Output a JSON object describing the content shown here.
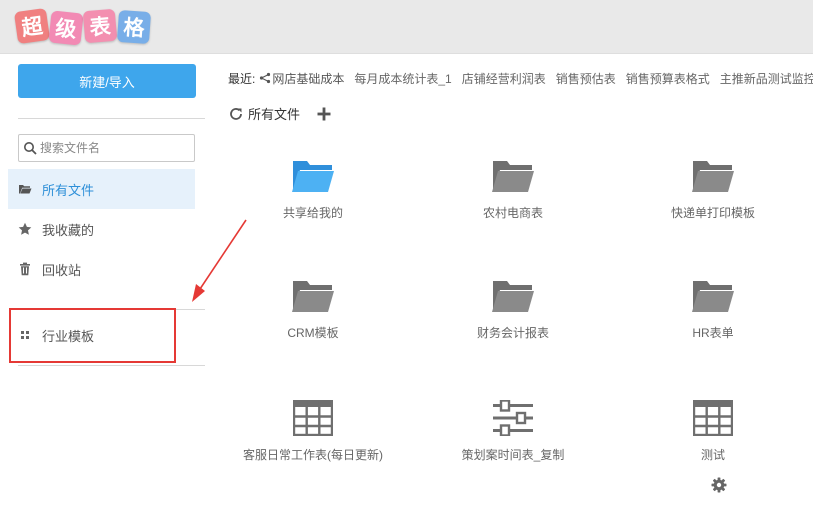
{
  "header": {
    "logo_chars": [
      "超",
      "级",
      "表",
      "格"
    ],
    "logo_colors": [
      "#f08080",
      "#f28ab4",
      "#f38fb0",
      "#78aee8"
    ]
  },
  "sidebar": {
    "new_button": "新建/导入",
    "search_placeholder": "搜索文件名",
    "items": [
      {
        "label": "所有文件",
        "icon": "folder-open-icon",
        "active": true
      },
      {
        "label": "我收藏的",
        "icon": "star-icon",
        "active": false
      },
      {
        "label": "回收站",
        "icon": "trash-icon",
        "active": false
      },
      {
        "label": "行业模板",
        "icon": "grid-icon",
        "active": false
      }
    ]
  },
  "main": {
    "recent_label": "最近:",
    "recent_items": [
      "网店基础成本",
      "每月成本统计表_1",
      "店铺经营利润表",
      "销售预估表",
      "销售预算表格式",
      "主推新品测试监控"
    ],
    "breadcrumb": "所有文件",
    "tiles": [
      {
        "label": "共享给我的",
        "icon": "shared-folder-icon",
        "color": "#3ea6ec"
      },
      {
        "label": "农村电商表",
        "icon": "folder-icon",
        "color": "#808080"
      },
      {
        "label": "快递单打印模板",
        "icon": "folder-icon",
        "color": "#808080"
      },
      {
        "label": "CRM模板",
        "icon": "folder-icon",
        "color": "#808080"
      },
      {
        "label": "财务会计报表",
        "icon": "folder-icon",
        "color": "#808080"
      },
      {
        "label": "HR表单",
        "icon": "folder-icon",
        "color": "#808080"
      },
      {
        "label": "客服日常工作表(每日更新)",
        "icon": "spreadsheet-icon",
        "color": "#808080"
      },
      {
        "label": "策划案时间表_复制",
        "icon": "sliders-icon",
        "color": "#808080"
      },
      {
        "label": "测试",
        "icon": "spreadsheet-icon",
        "color": "#808080"
      }
    ]
  },
  "colors": {
    "accent": "#3ea6ec",
    "annotation_red": "#e53935",
    "active_bg": "#e6f1fb"
  }
}
